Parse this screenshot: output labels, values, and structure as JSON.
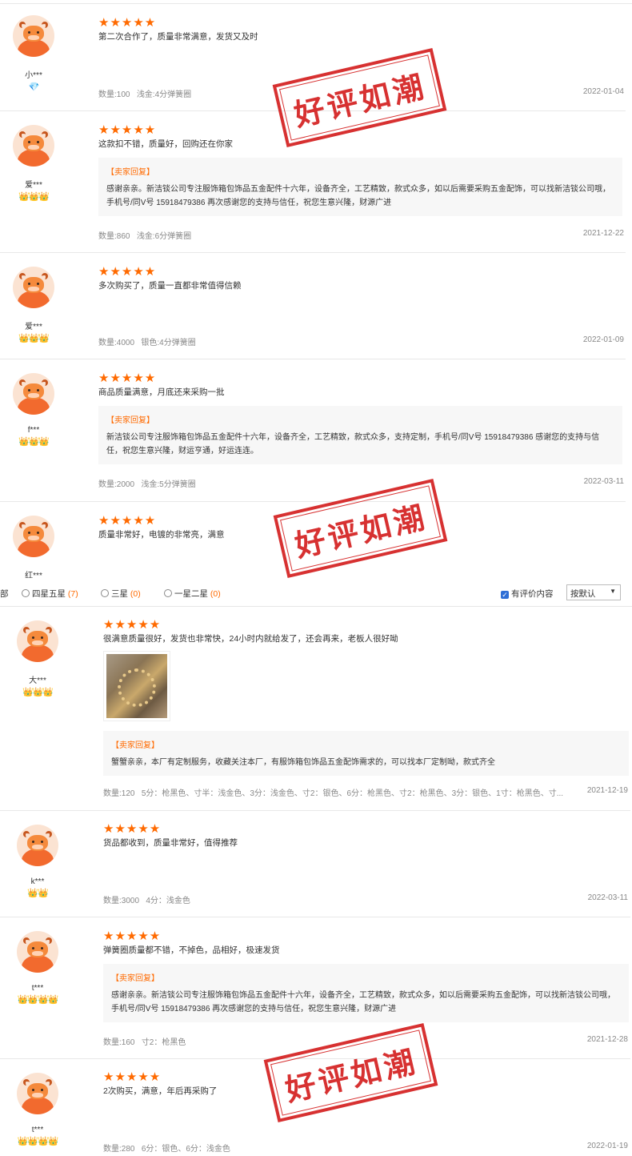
{
  "stamp_text": "好评如潮",
  "reply_title": "【卖家回复】",
  "labels": {
    "qty": "数量:"
  },
  "filter": {
    "cut_label": "部",
    "options": [
      {
        "label": "四星五星",
        "count": "(7)"
      },
      {
        "label": "三星",
        "count": "(0)"
      },
      {
        "label": "一星二星",
        "count": "(0)"
      }
    ],
    "checkbox_label": "有评价内容",
    "sort_selected": "按默认"
  },
  "reviews": [
    {
      "nick": "小***",
      "level": "💎",
      "stars": "★★★★★",
      "comment": "第二次合作了，质量非常满意，发货又及时",
      "qty": "100",
      "spec": "浅金:4分弹簧圈",
      "date": "2022-01-04"
    },
    {
      "nick": "爱***",
      "level": "👑👑👑",
      "stars": "★★★★★",
      "comment": "这款扣不错，质量好，回购还在你家",
      "reply": "感谢亲亲。新洁锬公司专注服饰箱包饰品五金配件十六年，设备齐全，工艺精致，款式众多，如以后需要采购五金配饰，可以找新洁锬公司哦，手机号/同V号 15918479386 再次感谢您的支持与信任，祝您生意兴隆，财源广进",
      "qty": "860",
      "spec": "浅金:6分弹簧圈",
      "date": "2021-12-22"
    },
    {
      "nick": "爱***",
      "level": "👑👑👑",
      "stars": "★★★★★",
      "comment": "多次购买了，质量一直都非常值得信赖",
      "qty": "4000",
      "spec": "银色:4分弹簧圈",
      "date": "2022-01-09"
    },
    {
      "nick": "f***",
      "level": "👑👑👑",
      "stars": "★★★★★",
      "comment": "商品质量满意，月底还来采购一批",
      "reply": "新洁锬公司专注服饰箱包饰品五金配件十六年，设备齐全，工艺精致，款式众多，支持定制，手机号/同V号 15918479386 感谢您的支持与信任，祝您生意兴隆，财运亨通，好运连连。",
      "qty": "2000",
      "spec": "浅金:5分弹簧圈",
      "date": "2022-03-11"
    },
    {
      "nick": "红***",
      "level": "",
      "stars": "★★★★★",
      "comment": "质量非常好，电镀的非常亮，满意"
    },
    {
      "nick": "大***",
      "level": "👑👑👑",
      "stars": "★★★★★",
      "comment": "很满意质量很好，发货也非常快，24小时内就给发了，还会再来，老板人很好呦",
      "reply": "蟹蟹亲亲，本厂有定制服务，收藏关注本厂，有服饰箱包饰品五金配饰需求的，可以找本厂定制呦，款式齐全",
      "qty": "120",
      "spec": "5分：枪黑色、寸半：浅金色、3分：浅金色、寸2：银色、6分：枪黑色、寸2：枪黑色、3分：银色、1寸：枪黑色、寸...",
      "date": "2021-12-19"
    },
    {
      "nick": "k***",
      "level": "👑👑",
      "stars": "★★★★★",
      "comment": "货品都收到，质量非常好，值得推荐",
      "qty": "3000",
      "spec": "4分：浅金色",
      "date": "2022-03-11"
    },
    {
      "nick": "t***",
      "level": "👑👑👑👑",
      "stars": "★★★★★",
      "comment": "弹簧圈质量都不错，不掉色，品相好，极速发货",
      "reply": "感谢亲亲。新洁锬公司专注服饰箱包饰品五金配件十六年，设备齐全，工艺精致，款式众多，如以后需要采购五金配饰，可以找新洁锬公司哦，手机号/同V号 15918479386 再次感谢您的支持与信任，祝您生意兴隆，财源广进",
      "qty": "160",
      "spec": "寸2：枪黑色",
      "date": "2021-12-28"
    },
    {
      "nick": "t***",
      "level": "👑👑👑👑",
      "stars": "★★★★★",
      "comment": "2次购买，满意，年后再采购了",
      "qty": "280",
      "spec": "6分：银色、6分：浅金色",
      "date": "2022-01-19"
    }
  ]
}
